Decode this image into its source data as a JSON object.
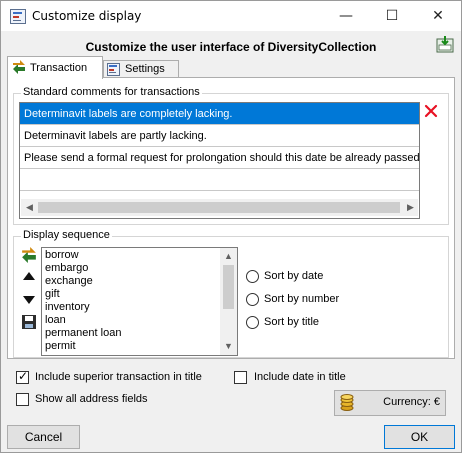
{
  "window": {
    "title": "Customize display",
    "controls": {
      "minimize": "—",
      "maximize": "☐",
      "close": "✕"
    }
  },
  "header": {
    "title": "Customize the user interface of DiversityCollection"
  },
  "tabs": [
    {
      "label": "Transaction",
      "active": true
    },
    {
      "label": "Settings",
      "active": false
    }
  ],
  "comments": {
    "group_label": "Standard comments for transactions",
    "items": [
      "Determinavit labels are completely lacking.",
      "Determinavit labels are partly lacking.",
      "Please send a formal request for prolongation should this date be already passed."
    ],
    "selected_index": 0
  },
  "sequence": {
    "group_label": "Display sequence",
    "items": [
      "borrow",
      "embargo",
      "exchange",
      "gift",
      "inventory",
      "loan",
      "permanent loan",
      "permit"
    ],
    "sort_options": [
      "Sort by date",
      "Sort by number",
      "Sort by title"
    ]
  },
  "options": {
    "include_superior": {
      "label": "Include superior transaction in title",
      "checked": true
    },
    "include_date": {
      "label": "Include date in title",
      "checked": false
    },
    "show_address": {
      "label": "Show all address fields",
      "checked": false
    }
  },
  "currency": {
    "label": "Currency: €"
  },
  "buttons": {
    "cancel": "Cancel",
    "ok": "OK"
  },
  "colors": {
    "selection": "#0078d7",
    "ok_border": "#0078d7",
    "delete": "#e81123"
  },
  "icons": [
    "app-icon",
    "export-icon",
    "transaction-icon",
    "settings-icon",
    "delete-icon",
    "up-arrow-icon",
    "down-arrow-icon",
    "save-icon",
    "coins-icon"
  ]
}
